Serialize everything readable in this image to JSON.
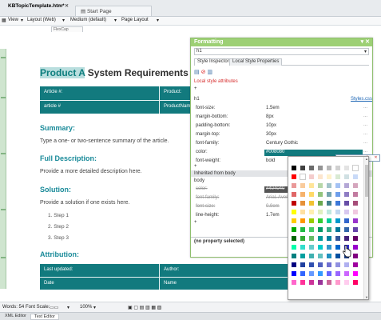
{
  "tabs": [
    {
      "label": "KBTopicTemplate.htm*"
    },
    {
      "label": "Start Page"
    }
  ],
  "toolbar": {
    "view_label": "View",
    "layout_label": "Layout (Web)",
    "style_label": "Medium (default)",
    "page_layout_label": "Page Layout"
  },
  "style_chip": "FlexCap rotatable",
  "document": {
    "title_highlight": "Product A",
    "title_rest": " System Requirements",
    "table1": {
      "headers": [
        "Article #:",
        "Product:"
      ],
      "values": [
        "article #",
        "ProductNam"
      ]
    },
    "summary_heading": "Summary:",
    "summary_text": "Type a one- or two-sentence summary of the article.",
    "full_heading": "Full Description:",
    "full_text": "Provide a more detailed description here.",
    "solution_heading": "Solution:",
    "solution_text": "Provide a solution if one exists here.",
    "steps": [
      "1.   Step 1",
      "2.   Step 2",
      "3.   Step 3"
    ],
    "attribution_heading": "Attribution:",
    "table2": {
      "headers": [
        "Last updated:",
        "Author:"
      ],
      "values": [
        "Date",
        "Name"
      ]
    }
  },
  "status": {
    "words": "Words: 54",
    "font_scale": "Font Scale:",
    "zoom": "100%"
  },
  "mode_tabs": [
    {
      "label": "XML Editor"
    },
    {
      "label": "Text Editor"
    }
  ],
  "formatting": {
    "title": "Formatting",
    "element": "h1",
    "tabs": [
      "Style Inspector",
      "Local Style Properties"
    ],
    "local_label": "Local style attributes",
    "plus": "+",
    "h1_label": "h1",
    "styles_link": "Styles.css",
    "props": [
      {
        "k": "font-size:",
        "v": "1.5em"
      },
      {
        "k": "margin-bottom:",
        "v": "8px"
      },
      {
        "k": "padding-bottom:",
        "v": "10px"
      },
      {
        "k": "margin-top:",
        "v": "30px"
      },
      {
        "k": "font-family:",
        "v": "Century Gothic"
      },
      {
        "k": "color:",
        "v": "#008080"
      },
      {
        "k": "font-weight:",
        "v": "bold"
      }
    ],
    "inherited_label": "Inherited from body",
    "body_label": "body",
    "body_props": [
      {
        "k": "color:",
        "v": "#404040"
      },
      {
        "k": "font-family:",
        "v": "Arial, Avenir, …"
      },
      {
        "k": "font-size:",
        "v": "0.9em"
      },
      {
        "k": "line-height:",
        "v": "1.7em"
      }
    ],
    "dots": "...",
    "no_property": "(no property selected)"
  },
  "color_box": {
    "value": "#4060a0"
  },
  "accent": "#127a7e",
  "palette": [
    [
      "#000000",
      "#404040",
      "#6b6b6b",
      "#949494",
      "#b8b8b8",
      "#d0d0d0",
      "#e3e3e3",
      "#ffffff"
    ],
    [
      "#ff0000",
      "#ffffff",
      "#f4cccc",
      "#fce5cd",
      "#fff2cc",
      "#d9ead3",
      "#d0e0e3",
      "#c9daf8"
    ],
    [
      "#ea9999",
      "#f9cb9c",
      "#ffe599",
      "#b6d7a8",
      "#a2c4c9",
      "#a4c2f4",
      "#b4a7d6",
      "#d5a6bd"
    ],
    [
      "#e06666",
      "#f6b26b",
      "#ffd966",
      "#93c47d",
      "#76a5af",
      "#6d9eeb",
      "#8e7cc3",
      "#c27ba0"
    ],
    [
      "#c00000",
      "#e69138",
      "#f1c232",
      "#6aa84f",
      "#45818e",
      "#3c78d8",
      "#674ea7",
      "#a64d79"
    ],
    [
      "#ffff00",
      "#ffe0a0",
      "#fff0b0",
      "#e0f0c0",
      "#c0e8e0",
      "#c0d8f0",
      "#d8c8f0",
      "#f0c8e0"
    ],
    [
      "#ffcc00",
      "#ff9900",
      "#99cc00",
      "#33cc33",
      "#00cc99",
      "#0099cc",
      "#3366cc",
      "#9933cc"
    ],
    [
      "#00aa00",
      "#22bb44",
      "#44cc66",
      "#009966",
      "#33aa88",
      "#007799",
      "#3366aa",
      "#6644aa"
    ],
    [
      "#006600",
      "#33aa33",
      "#66bb66",
      "#009999",
      "#0080a0",
      "#335599",
      "#44227a",
      "#660066"
    ],
    [
      "#00ffaa",
      "#33ddcc",
      "#66cccc",
      "#00cccc",
      "#3399cc",
      "#0066cc",
      "#3333cc",
      "#9900cc"
    ],
    [
      "#008080",
      "#00a0a0",
      "#40b0b0",
      "#60c0c0",
      "#2090c0",
      "#0050a0",
      "#1c3d80",
      "#800080"
    ],
    [
      "#000080",
      "#2040a0",
      "#3050b0",
      "#5060c0",
      "#7070d0",
      "#9090e0",
      "#b0b0f0",
      "#a000a0"
    ],
    [
      "#0000ff",
      "#3366ff",
      "#6699ff",
      "#3399ff",
      "#6666ff",
      "#9966ff",
      "#cc66ff",
      "#ff00ff"
    ],
    [
      "#ff66cc",
      "#ff3399",
      "#cc3399",
      "#993399",
      "#cc6699",
      "#ff99cc",
      "#ffccee",
      "#ff0066"
    ]
  ]
}
